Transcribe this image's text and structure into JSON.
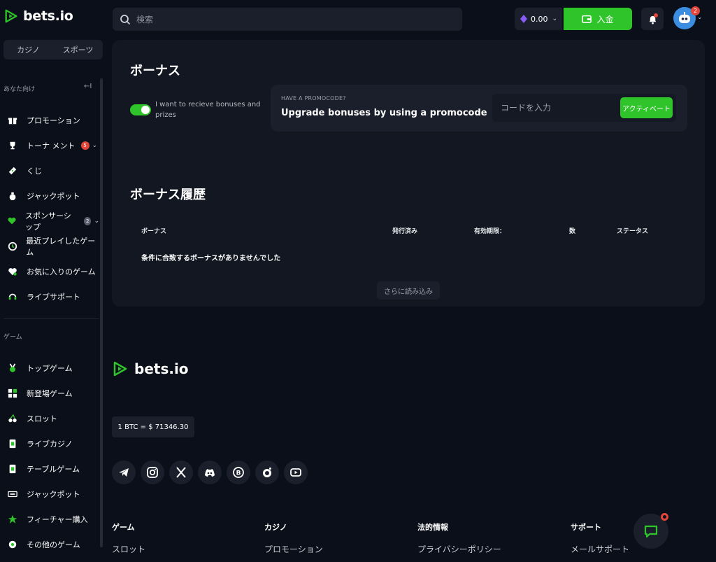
{
  "brand": {
    "name": "bets.io"
  },
  "colors": {
    "accent": "#2fc42a",
    "background": "#0b0f19",
    "panel": "#121721",
    "badge_red": "#e2463a"
  },
  "sidebar": {
    "tabs": [
      {
        "label": "カジノ"
      },
      {
        "label": "スポーツ"
      }
    ],
    "section_for_you": "あなた向け",
    "collapse_icon": "←I",
    "items": [
      {
        "label": "プロモーション",
        "icon": "gift-icon"
      },
      {
        "label": "トーナ メント",
        "icon": "trophy-icon",
        "badge": "5"
      },
      {
        "label": "くじ",
        "icon": "ticket-icon"
      },
      {
        "label": "ジャックポット",
        "icon": "moneybag-icon"
      },
      {
        "label": "スポンサーシップ",
        "icon": "heart-hand-icon",
        "badge": "2"
      },
      {
        "label": "最近プレイしたゲーム",
        "icon": "history-icon"
      },
      {
        "label": "お気に入りのゲーム",
        "icon": "heart-icon"
      },
      {
        "label": "ライブサポート",
        "icon": "headset-icon"
      }
    ],
    "section_games": "ゲーム",
    "game_items": [
      {
        "label": "トップゲーム",
        "icon": "medal-icon"
      },
      {
        "label": "新登場ゲーム",
        "icon": "grid-plus-icon"
      },
      {
        "label": "スロット",
        "icon": "cherry-icon"
      },
      {
        "label": "ライブカジノ",
        "icon": "live-card-icon"
      },
      {
        "label": "テーブルゲーム",
        "icon": "table-card-icon"
      },
      {
        "label": "ジャックポット",
        "icon": "jackpot-icon"
      },
      {
        "label": "フィーチャー購入",
        "icon": "feature-icon"
      },
      {
        "label": "その他のゲーム",
        "icon": "more-games-icon"
      }
    ]
  },
  "header": {
    "search_placeholder": "検索",
    "balance": "0.00",
    "deposit_label": "入金",
    "avatar_badge": "2"
  },
  "bonus": {
    "title": "ボーナス",
    "toggle_label": "I want to recieve bonuses and prizes",
    "toggle_on": true,
    "promo_small": "HAVE A PROMOCODE?",
    "promo_big": "Upgrade bonuses by using a promocode",
    "promo_placeholder": "コードを入力",
    "activate_label": "アクティベート"
  },
  "history": {
    "title": "ボーナス履歴",
    "columns": [
      "ボーナス",
      "発行済み",
      "有効期限：",
      "数",
      "ステータス"
    ],
    "empty_message": "条件に合致するボーナスがありませんでした",
    "load_more": "さらに読み込み"
  },
  "footer": {
    "brand": "bets.io",
    "btc_rate": "1 BTC = $ 71346.30",
    "socials": [
      "telegram-icon",
      "instagram-icon",
      "x-icon",
      "discord-icon",
      "bitcointalk-icon",
      "reddit-icon",
      "youtube-icon"
    ],
    "columns": [
      {
        "heading": "ゲーム",
        "link": "スロット"
      },
      {
        "heading": "カジノ",
        "link": "プロモーション"
      },
      {
        "heading": "法的情報",
        "link": "プライバシーポリシー"
      },
      {
        "heading": "サポート",
        "link": "メールサポート"
      }
    ]
  }
}
